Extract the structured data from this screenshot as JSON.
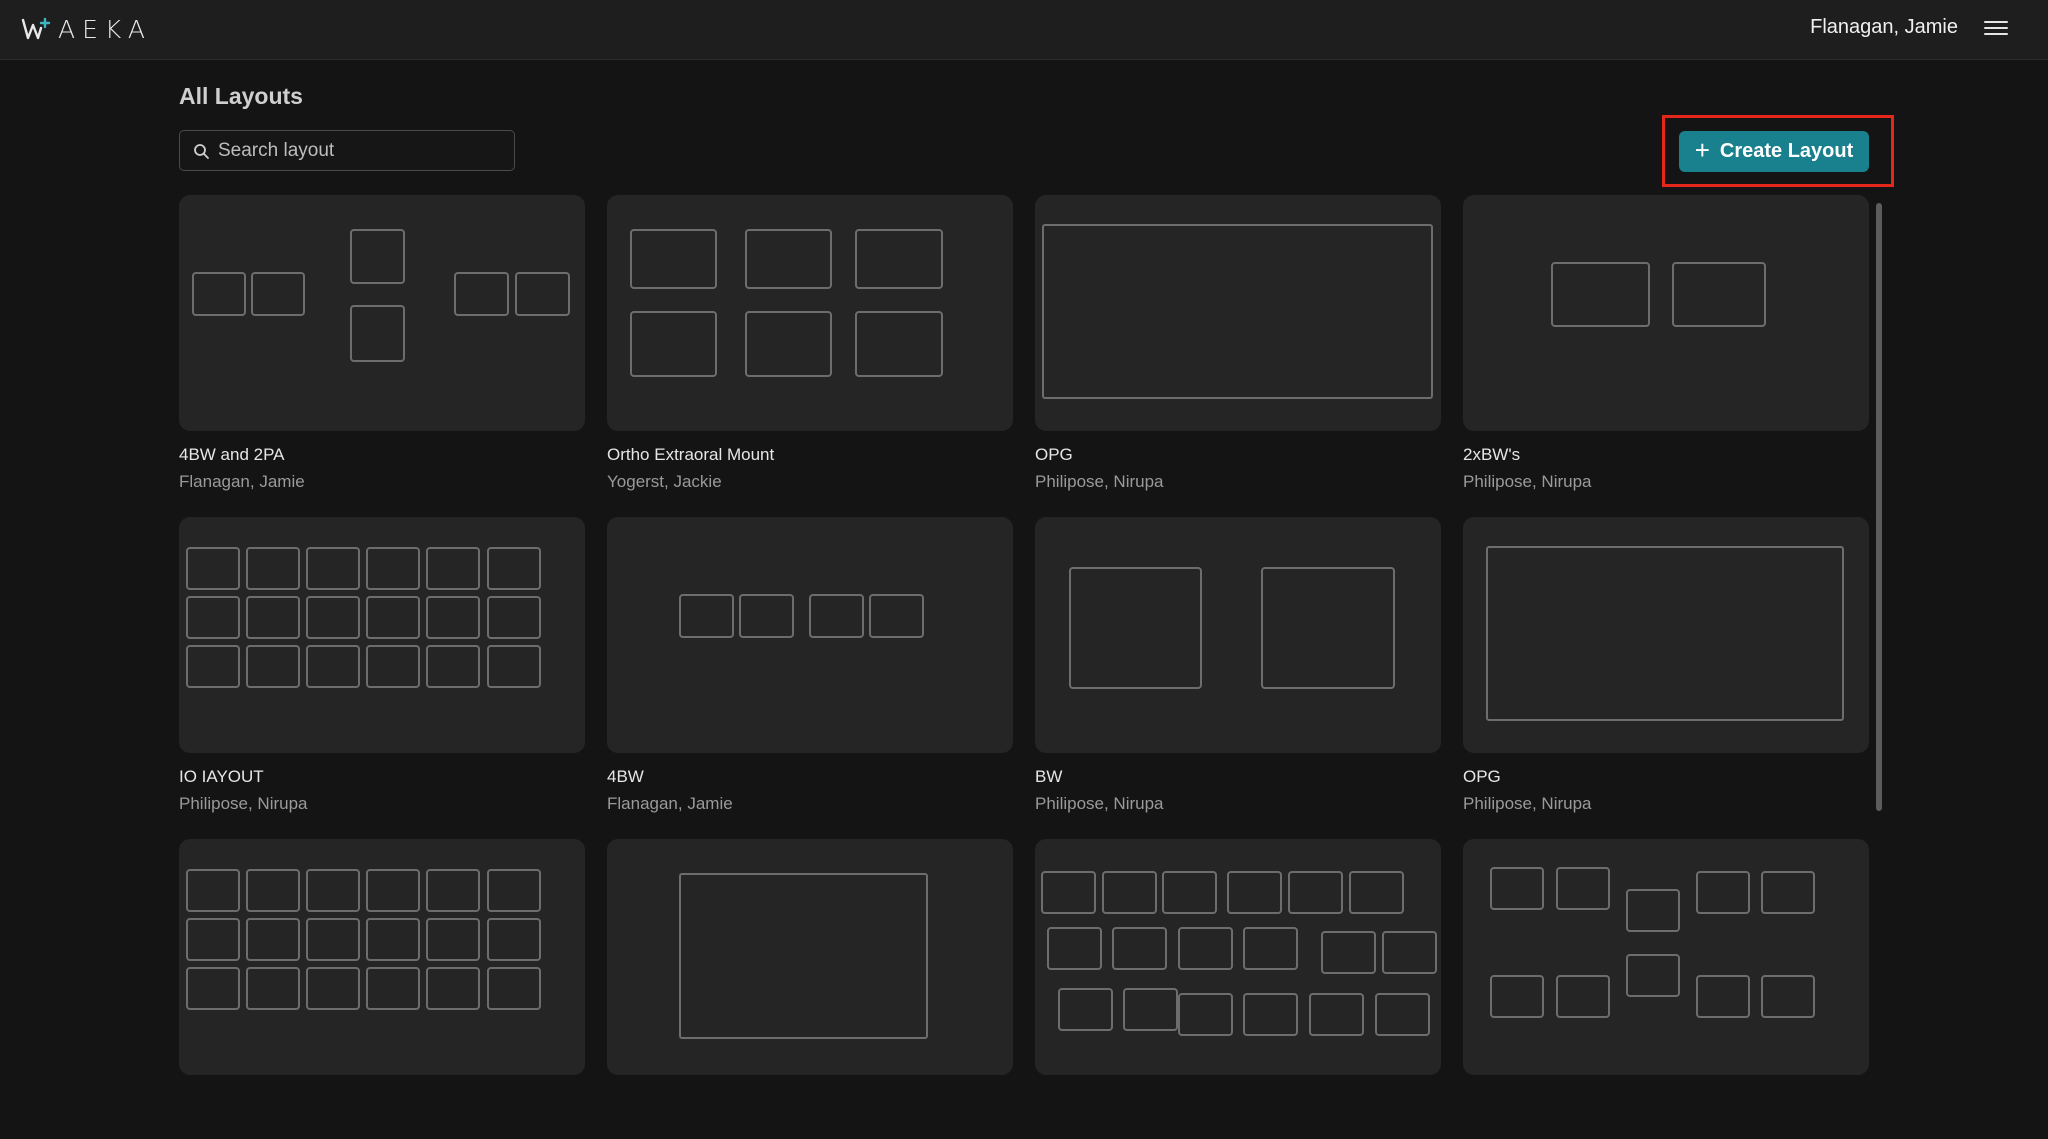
{
  "app": {
    "brand": "AEKA",
    "user_name": "Flanagan, Jamie"
  },
  "page": {
    "title": "All Layouts"
  },
  "search": {
    "placeholder": "Search layout",
    "value": ""
  },
  "actions": {
    "create_label": "Create Layout"
  },
  "colors": {
    "accent": "#19808d",
    "highlight": "#e5261a",
    "card_bg": "#252525",
    "page_bg": "#141414"
  },
  "layouts": [
    {
      "name": "4BW and 2PA",
      "author": "Flanagan, Jamie"
    },
    {
      "name": "Ortho Extraoral Mount",
      "author": "Yogerst, Jackie"
    },
    {
      "name": "OPG",
      "author": "Philipose, Nirupa"
    },
    {
      "name": "2xBW's",
      "author": "Philipose, Nirupa"
    },
    {
      "name": "IO IAYOUT",
      "author": "Philipose, Nirupa"
    },
    {
      "name": "4BW",
      "author": "Flanagan, Jamie"
    },
    {
      "name": "BW",
      "author": "Philipose, Nirupa"
    },
    {
      "name": "OPG",
      "author": "Philipose, Nirupa"
    },
    {
      "name": "",
      "author": ""
    },
    {
      "name": "",
      "author": ""
    },
    {
      "name": "",
      "author": ""
    },
    {
      "name": "",
      "author": ""
    }
  ]
}
